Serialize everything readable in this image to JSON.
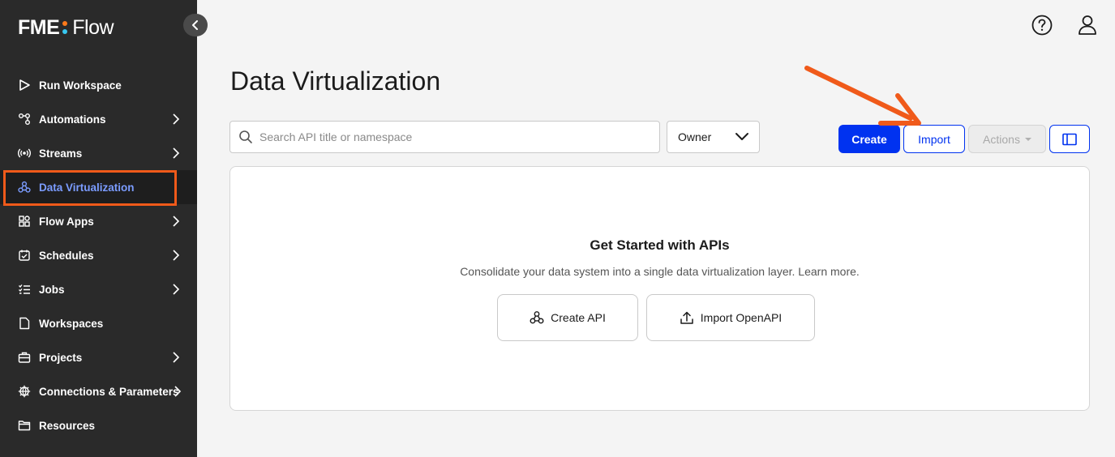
{
  "app": {
    "logo_left": "FME",
    "logo_right": "Flow",
    "brand_colors": {
      "dot_top": "#ff7a1a",
      "dot_bottom": "#38c7f0",
      "accent": "#0032f0",
      "highlight": "#f05a1a"
    }
  },
  "sidebar": {
    "items": [
      {
        "label": "Run Workspace",
        "icon": "play-icon",
        "has_chevron": false
      },
      {
        "label": "Automations",
        "icon": "automations-icon",
        "has_chevron": true
      },
      {
        "label": "Streams",
        "icon": "streams-icon",
        "has_chevron": true
      },
      {
        "label": "Data Virtualization",
        "icon": "data-virtualization-icon",
        "has_chevron": false,
        "active": true
      },
      {
        "label": "Flow Apps",
        "icon": "flow-apps-icon",
        "has_chevron": true
      },
      {
        "label": "Schedules",
        "icon": "calendar-icon",
        "has_chevron": true
      },
      {
        "label": "Jobs",
        "icon": "jobs-list-icon",
        "has_chevron": true
      },
      {
        "label": "Workspaces",
        "icon": "document-icon",
        "has_chevron": false
      },
      {
        "label": "Projects",
        "icon": "briefcase-icon",
        "has_chevron": true
      },
      {
        "label": "Connections & Parameters",
        "icon": "globe-gear-icon",
        "has_chevron": true
      },
      {
        "label": "Resources",
        "icon": "folder-icon",
        "has_chevron": false
      }
    ]
  },
  "header": {
    "help_icon": "help-icon",
    "user_icon": "user-icon"
  },
  "main": {
    "title": "Data Virtualization",
    "search": {
      "placeholder": "Search API title or namespace",
      "value": ""
    },
    "owner_filter": {
      "label": "Owner"
    },
    "buttons": {
      "create": "Create",
      "import": "Import",
      "actions": "Actions"
    },
    "empty_state": {
      "title": "Get Started with APIs",
      "description": "Consolidate your data system into a single data virtualization layer. Learn more.",
      "create_api": "Create API",
      "import_openapi": "Import OpenAPI"
    }
  }
}
